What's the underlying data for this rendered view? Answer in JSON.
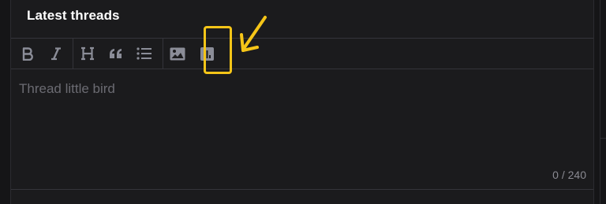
{
  "panel": {
    "title": "Latest threads"
  },
  "toolbar": {
    "buttons": [
      {
        "name": "bold",
        "icon": "bold-icon"
      },
      {
        "name": "italic",
        "icon": "italic-icon"
      },
      {
        "name": "heading",
        "icon": "heading-icon"
      },
      {
        "name": "quote",
        "icon": "quote-icon"
      },
      {
        "name": "list",
        "icon": "list-icon"
      },
      {
        "name": "image",
        "icon": "image-icon"
      },
      {
        "name": "poll",
        "icon": "poll-chart-icon"
      }
    ]
  },
  "editor": {
    "placeholder": "Thread little bird",
    "counter": "0 / 240"
  },
  "annotation": {
    "highlight_color": "#f5c518",
    "highlighted_button": "poll"
  },
  "colors": {
    "background": "#151517",
    "panel": "#1b1b1d",
    "icon": "#8b8d98",
    "accent": "#f5c518"
  }
}
